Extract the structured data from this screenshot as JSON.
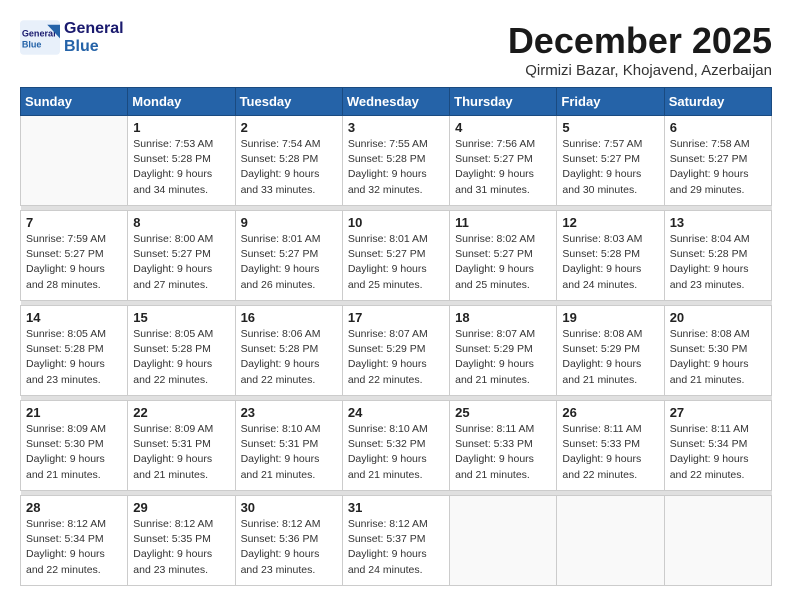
{
  "logo": {
    "line1": "General",
    "line2": "Blue"
  },
  "title": "December 2025",
  "subtitle": "Qirmizi Bazar, Khojavend, Azerbaijan",
  "days_of_week": [
    "Sunday",
    "Monday",
    "Tuesday",
    "Wednesday",
    "Thursday",
    "Friday",
    "Saturday"
  ],
  "weeks": [
    [
      {
        "day": "",
        "info": ""
      },
      {
        "day": "1",
        "info": "Sunrise: 7:53 AM\nSunset: 5:28 PM\nDaylight: 9 hours\nand 34 minutes."
      },
      {
        "day": "2",
        "info": "Sunrise: 7:54 AM\nSunset: 5:28 PM\nDaylight: 9 hours\nand 33 minutes."
      },
      {
        "day": "3",
        "info": "Sunrise: 7:55 AM\nSunset: 5:28 PM\nDaylight: 9 hours\nand 32 minutes."
      },
      {
        "day": "4",
        "info": "Sunrise: 7:56 AM\nSunset: 5:27 PM\nDaylight: 9 hours\nand 31 minutes."
      },
      {
        "day": "5",
        "info": "Sunrise: 7:57 AM\nSunset: 5:27 PM\nDaylight: 9 hours\nand 30 minutes."
      },
      {
        "day": "6",
        "info": "Sunrise: 7:58 AM\nSunset: 5:27 PM\nDaylight: 9 hours\nand 29 minutes."
      }
    ],
    [
      {
        "day": "7",
        "info": "Sunrise: 7:59 AM\nSunset: 5:27 PM\nDaylight: 9 hours\nand 28 minutes."
      },
      {
        "day": "8",
        "info": "Sunrise: 8:00 AM\nSunset: 5:27 PM\nDaylight: 9 hours\nand 27 minutes."
      },
      {
        "day": "9",
        "info": "Sunrise: 8:01 AM\nSunset: 5:27 PM\nDaylight: 9 hours\nand 26 minutes."
      },
      {
        "day": "10",
        "info": "Sunrise: 8:01 AM\nSunset: 5:27 PM\nDaylight: 9 hours\nand 25 minutes."
      },
      {
        "day": "11",
        "info": "Sunrise: 8:02 AM\nSunset: 5:27 PM\nDaylight: 9 hours\nand 25 minutes."
      },
      {
        "day": "12",
        "info": "Sunrise: 8:03 AM\nSunset: 5:28 PM\nDaylight: 9 hours\nand 24 minutes."
      },
      {
        "day": "13",
        "info": "Sunrise: 8:04 AM\nSunset: 5:28 PM\nDaylight: 9 hours\nand 23 minutes."
      }
    ],
    [
      {
        "day": "14",
        "info": "Sunrise: 8:05 AM\nSunset: 5:28 PM\nDaylight: 9 hours\nand 23 minutes."
      },
      {
        "day": "15",
        "info": "Sunrise: 8:05 AM\nSunset: 5:28 PM\nDaylight: 9 hours\nand 22 minutes."
      },
      {
        "day": "16",
        "info": "Sunrise: 8:06 AM\nSunset: 5:28 PM\nDaylight: 9 hours\nand 22 minutes."
      },
      {
        "day": "17",
        "info": "Sunrise: 8:07 AM\nSunset: 5:29 PM\nDaylight: 9 hours\nand 22 minutes."
      },
      {
        "day": "18",
        "info": "Sunrise: 8:07 AM\nSunset: 5:29 PM\nDaylight: 9 hours\nand 21 minutes."
      },
      {
        "day": "19",
        "info": "Sunrise: 8:08 AM\nSunset: 5:29 PM\nDaylight: 9 hours\nand 21 minutes."
      },
      {
        "day": "20",
        "info": "Sunrise: 8:08 AM\nSunset: 5:30 PM\nDaylight: 9 hours\nand 21 minutes."
      }
    ],
    [
      {
        "day": "21",
        "info": "Sunrise: 8:09 AM\nSunset: 5:30 PM\nDaylight: 9 hours\nand 21 minutes."
      },
      {
        "day": "22",
        "info": "Sunrise: 8:09 AM\nSunset: 5:31 PM\nDaylight: 9 hours\nand 21 minutes."
      },
      {
        "day": "23",
        "info": "Sunrise: 8:10 AM\nSunset: 5:31 PM\nDaylight: 9 hours\nand 21 minutes."
      },
      {
        "day": "24",
        "info": "Sunrise: 8:10 AM\nSunset: 5:32 PM\nDaylight: 9 hours\nand 21 minutes."
      },
      {
        "day": "25",
        "info": "Sunrise: 8:11 AM\nSunset: 5:33 PM\nDaylight: 9 hours\nand 21 minutes."
      },
      {
        "day": "26",
        "info": "Sunrise: 8:11 AM\nSunset: 5:33 PM\nDaylight: 9 hours\nand 22 minutes."
      },
      {
        "day": "27",
        "info": "Sunrise: 8:11 AM\nSunset: 5:34 PM\nDaylight: 9 hours\nand 22 minutes."
      }
    ],
    [
      {
        "day": "28",
        "info": "Sunrise: 8:12 AM\nSunset: 5:34 PM\nDaylight: 9 hours\nand 22 minutes."
      },
      {
        "day": "29",
        "info": "Sunrise: 8:12 AM\nSunset: 5:35 PM\nDaylight: 9 hours\nand 23 minutes."
      },
      {
        "day": "30",
        "info": "Sunrise: 8:12 AM\nSunset: 5:36 PM\nDaylight: 9 hours\nand 23 minutes."
      },
      {
        "day": "31",
        "info": "Sunrise: 8:12 AM\nSunset: 5:37 PM\nDaylight: 9 hours\nand 24 minutes."
      },
      {
        "day": "",
        "info": ""
      },
      {
        "day": "",
        "info": ""
      },
      {
        "day": "",
        "info": ""
      }
    ]
  ]
}
